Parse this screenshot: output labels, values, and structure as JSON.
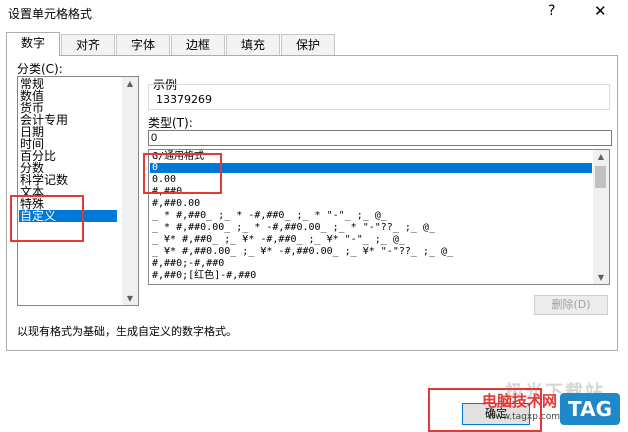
{
  "window": {
    "title": "设置单元格格式",
    "help_glyph": "?",
    "close_glyph": "✕"
  },
  "tabs": [
    {
      "label": "数字",
      "active": true
    },
    {
      "label": "对齐",
      "active": false
    },
    {
      "label": "字体",
      "active": false
    },
    {
      "label": "边框",
      "active": false
    },
    {
      "label": "填充",
      "active": false
    },
    {
      "label": "保护",
      "active": false
    }
  ],
  "category": {
    "label": "分类(C):",
    "items": [
      "常规",
      "数值",
      "货币",
      "会计专用",
      "日期",
      "时间",
      "百分比",
      "分数",
      "科学记数",
      "文本",
      "特殊",
      "自定义"
    ],
    "selected": "自定义"
  },
  "sample": {
    "label": "示例",
    "value": "13379269"
  },
  "type": {
    "label": "类型(T):",
    "value": "0"
  },
  "formats": {
    "items": [
      "G/通用格式",
      "0",
      "0.00",
      "#,##0",
      "#,##0.00",
      "_ * #,##0_ ;_ * -#,##0_ ;_ * \"-\"_ ;_ @_ ",
      "_ * #,##0.00_ ;_ * -#,##0.00_ ;_ * \"-\"??_ ;_ @_ ",
      "_ ¥* #,##0_ ;_ ¥* -#,##0_ ;_ ¥* \"-\"_ ;_ @_ ",
      "_ ¥* #,##0.00_ ;_ ¥* -#,##0.00_ ;_ ¥* \"-\"??_ ;_ @_ ",
      "#,##0;-#,##0",
      "#,##0;[红色]-#,##0"
    ],
    "selected": "0"
  },
  "delete_button": "删除(D)",
  "description": "以现有格式为基础，生成自定义的数字格式。",
  "ok_button": "确定",
  "watermark": {
    "site_name": "电脑技术网",
    "url": "www.tagxp.com",
    "badge": "TAG",
    "faint_text": "极光下载站"
  },
  "colors": {
    "selection": "#0078d7",
    "highlight_box": "#e53935",
    "watermark_red": "#e53935",
    "badge_blue": "#1e88c8"
  }
}
